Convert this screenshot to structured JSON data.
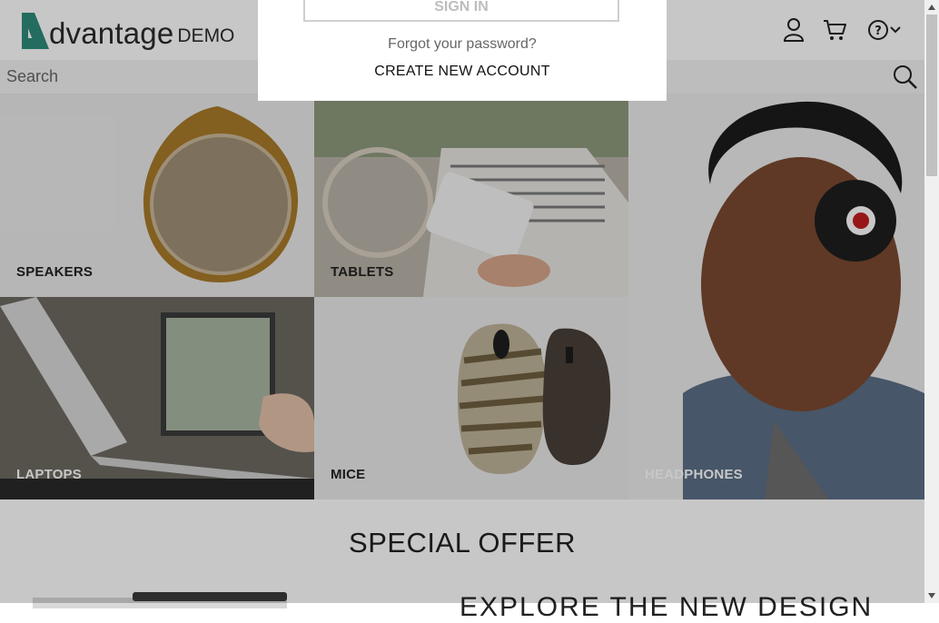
{
  "brand": {
    "logo_letter_rest": "dvantage",
    "logo_demo": "DEMO",
    "accent": "#2e8b7a"
  },
  "header": {
    "icons": [
      "user-icon",
      "cart-icon",
      "help-icon",
      "chevron-down-icon"
    ]
  },
  "search": {
    "placeholder": "Search",
    "value": "",
    "icon": "search-icon"
  },
  "login_popup": {
    "signin_label": "SIGN IN",
    "forgot_label": "Forgot your password?",
    "create_label": "CREATE NEW ACCOUNT"
  },
  "categories": [
    {
      "label": "SPEAKERS"
    },
    {
      "label": "TABLETS"
    },
    {
      "label": "HEADPHONES"
    },
    {
      "label": "LAPTOPS"
    },
    {
      "label": "MICE"
    }
  ],
  "special_offer": {
    "title": "SPECIAL OFFER",
    "headline": "EXPLORE THE NEW DESIGN"
  },
  "colors": {
    "overlay": "rgba(0,0,0,0.22)",
    "tile_bg": "#dcdcdc"
  }
}
